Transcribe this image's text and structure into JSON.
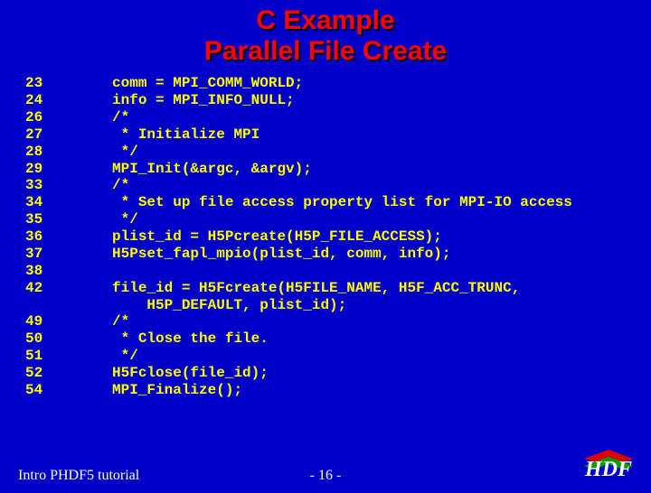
{
  "title": {
    "line1": "C Example",
    "line2": "Parallel File Create"
  },
  "code": [
    {
      "n": "23",
      "t": "    comm = MPI_COMM_WORLD;"
    },
    {
      "n": "24",
      "t": "    info = MPI_INFO_NULL;"
    },
    {
      "n": "26",
      "t": "    /*"
    },
    {
      "n": "27",
      "t": "     * Initialize MPI"
    },
    {
      "n": "28",
      "t": "     */"
    },
    {
      "n": "29",
      "t": "    MPI_Init(&argc, &argv);"
    },
    {
      "n": "33",
      "t": "    /*"
    },
    {
      "n": "34",
      "t": "     * Set up file access property list for MPI-IO access"
    },
    {
      "n": "35",
      "t": "     */"
    },
    {
      "n": "36",
      "t": "    plist_id = H5Pcreate(H5P_FILE_ACCESS);"
    },
    {
      "n": "37",
      "t": "    H5Pset_fapl_mpio(plist_id, comm, info);"
    },
    {
      "n": "38",
      "t": ""
    },
    {
      "n": "42",
      "t": "    file_id = H5Fcreate(H5FILE_NAME, H5F_ACC_TRUNC,"
    },
    {
      "n": "",
      "t": "        H5P_DEFAULT, plist_id);"
    },
    {
      "n": "49",
      "t": "    /*"
    },
    {
      "n": "50",
      "t": "     * Close the file."
    },
    {
      "n": "51",
      "t": "     */"
    },
    {
      "n": "52",
      "t": "    H5Fclose(file_id);"
    },
    {
      "n": "54",
      "t": "    MPI_Finalize();"
    }
  ],
  "footer": {
    "left": "Intro PHDF5 tutorial",
    "center": "- 16 -",
    "logo_text": "HDF"
  }
}
